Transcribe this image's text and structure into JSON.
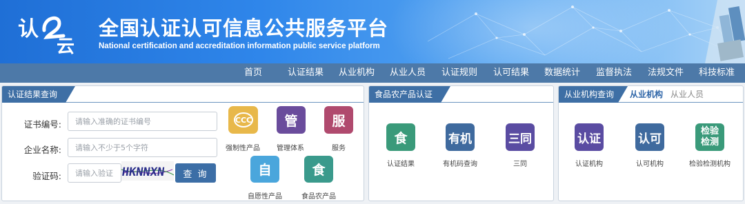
{
  "header": {
    "logo_text": [
      "认",
      "云"
    ],
    "title": "全国认证认可信息公共服务平台",
    "subtitle": "National certification and accreditation information public service platform"
  },
  "nav": [
    "首页",
    "认证结果",
    "从业机构",
    "从业人员",
    "认证规则",
    "认可结果",
    "数据统计",
    "监督执法",
    "法规文件",
    "科技标准"
  ],
  "cert_query": {
    "tab": "认证结果查询",
    "cert_no_label": "证书编号:",
    "cert_no_placeholder": "请输入准确的证书编号",
    "company_label": "企业名称:",
    "company_placeholder": "请输入不少于5个字符",
    "captcha_label": "验证码:",
    "captcha_placeholder": "请输入验证",
    "captcha_text": "HKNNXN",
    "button": "查 询",
    "icons": [
      {
        "glyph": "",
        "caption": "强制性产品",
        "icon": "ccc-icon"
      },
      {
        "glyph": "管",
        "caption": "管理体系"
      },
      {
        "glyph": "服",
        "caption": "服务"
      },
      {
        "glyph": "自",
        "caption": "自愿性产品"
      },
      {
        "glyph": "食",
        "caption": "食品农产品"
      }
    ]
  },
  "food_cert": {
    "tab": "食品农产品认证",
    "items": [
      {
        "glyph": "食",
        "caption": "认证结果"
      },
      {
        "glyph": "有机",
        "caption": "有机码查询"
      },
      {
        "glyph": "三同",
        "caption": "三同"
      }
    ]
  },
  "org_query": {
    "tab": "从业机构查询",
    "sub_tabs": [
      "从业机构",
      "从业人员"
    ],
    "items": [
      {
        "glyph": "认证",
        "caption": "认证机构"
      },
      {
        "glyph": "认可",
        "caption": "认可机构"
      },
      {
        "glyph": "检验\n检测",
        "glyph_lines": [
          "检验",
          "检测"
        ],
        "caption": "检验检测机构"
      }
    ]
  },
  "colors": {
    "nav_bg": "#4d79a8",
    "tab_bg": "#3e6fa5",
    "ccc": "#e8b84a",
    "purple": "#6a4c9c",
    "rose": "#b04a6e",
    "sky": "#4aa6dc",
    "teal": "#3a9a8c",
    "steel": "#3f6a9e",
    "violet": "#5a4ca2",
    "green": "#3a9a7a"
  }
}
